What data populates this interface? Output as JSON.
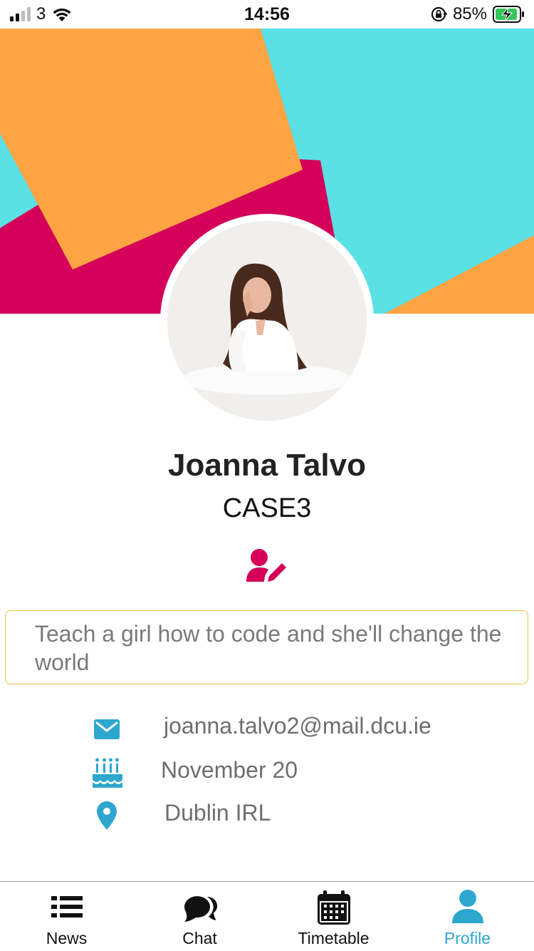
{
  "status_bar": {
    "carrier": "3",
    "time": "14:56",
    "battery_percent": "85%",
    "signal_bars_active": 2,
    "signal_bars_total": 4,
    "icons": [
      "signal-icon",
      "wifi-icon",
      "orientation-lock-icon",
      "battery-charging-icon"
    ]
  },
  "banner": {
    "colors": {
      "cyan": "#5be0e6",
      "orange": "#ffa443",
      "crimson": "#d4005a"
    }
  },
  "profile": {
    "name": "Joanna Talvo",
    "course": "CASE3",
    "bio": "Teach a girl how to code and she'll change the world",
    "email": "joanna.talvo2@mail.dcu.ie",
    "birthday": "November 20",
    "location": "Dublin IRL"
  },
  "colors": {
    "accent": "#2ea7cf",
    "edit_icon": "#d4005a",
    "bio_border": "#f2c040"
  },
  "nav": {
    "items": [
      {
        "label": "News",
        "icon": "list-icon",
        "active": false
      },
      {
        "label": "Chat",
        "icon": "chat-bubbles-icon",
        "active": false
      },
      {
        "label": "Timetable",
        "icon": "calendar-icon",
        "active": false
      },
      {
        "label": "Profile",
        "icon": "user-icon",
        "active": true
      }
    ]
  }
}
